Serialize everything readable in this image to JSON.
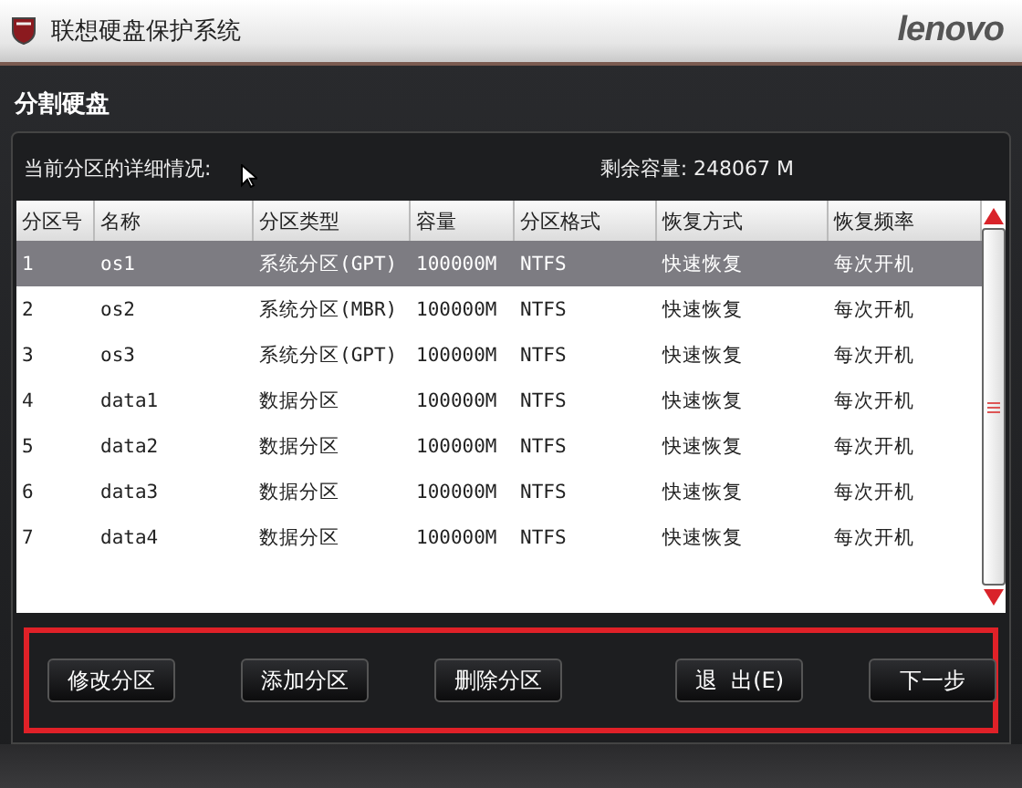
{
  "window": {
    "title": "联想硬盘保护系统",
    "logo": "lenovo"
  },
  "section_title": "分割硬盘",
  "info": {
    "label": "当前分区的详细情况:",
    "free_space": "剩余容量: 248067 M"
  },
  "table": {
    "columns": [
      "分区号",
      "名称",
      "分区类型",
      "容量",
      "分区格式",
      "恢复方式",
      "恢复频率"
    ],
    "rows": [
      {
        "cells": [
          "1",
          "os1",
          "系统分区(GPT)",
          "100000M",
          "NTFS",
          "快速恢复",
          "每次开机"
        ],
        "selected": true
      },
      {
        "cells": [
          "2",
          "os2",
          "系统分区(MBR)",
          "100000M",
          "NTFS",
          "快速恢复",
          "每次开机"
        ],
        "selected": false
      },
      {
        "cells": [
          "3",
          "os3",
          "系统分区(GPT)",
          "100000M",
          "NTFS",
          "快速恢复",
          "每次开机"
        ],
        "selected": false
      },
      {
        "cells": [
          "4",
          "data1",
          "数据分区",
          "100000M",
          "NTFS",
          "快速恢复",
          "每次开机"
        ],
        "selected": false
      },
      {
        "cells": [
          "5",
          "data2",
          "数据分区",
          "100000M",
          "NTFS",
          "快速恢复",
          "每次开机"
        ],
        "selected": false
      },
      {
        "cells": [
          "6",
          "data3",
          "数据分区",
          "100000M",
          "NTFS",
          "快速恢复",
          "每次开机"
        ],
        "selected": false
      },
      {
        "cells": [
          "7",
          "data4",
          "数据分区",
          "100000M",
          "NTFS",
          "快速恢复",
          "每次开机"
        ],
        "selected": false
      }
    ]
  },
  "buttons": [
    "修改分区",
    "添加分区",
    "删除分区",
    "退  出(E)",
    "下一步"
  ]
}
